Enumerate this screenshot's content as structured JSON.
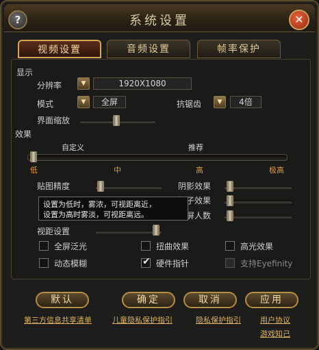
{
  "window": {
    "title": "系统设置",
    "help_label": "?",
    "close_label": "✕"
  },
  "tabs": [
    {
      "label": "视频设置",
      "active": true
    },
    {
      "label": "音频设置",
      "active": false
    },
    {
      "label": "帧率保护",
      "active": false
    }
  ],
  "display": {
    "section": "显示",
    "resolution": {
      "label": "分辨率",
      "value": "1920X1080"
    },
    "mode": {
      "label": "模式",
      "value": "全屏"
    },
    "antialias": {
      "label": "抗锯齿",
      "value": "4倍"
    },
    "ui_scale": {
      "label": "界面缩放"
    },
    "dropdown_arrow": "▼"
  },
  "effects": {
    "section": "效果",
    "preset_top_labels": [
      "自定义",
      "推荐"
    ],
    "preset_ticks": [
      "低",
      "中",
      "高",
      "极高"
    ],
    "texture": {
      "label": "贴图精度"
    },
    "shadow": {
      "label": "阴影效果"
    },
    "particle": {
      "label": "粒子效果"
    },
    "same_screen": {
      "label": "同屏人数"
    },
    "view_distance": {
      "label": "视距设置"
    },
    "tooltip": [
      "设置为低时，雾浓，可视距离近，",
      "设置为高时雾淡，可视距离远。"
    ]
  },
  "checkboxes": [
    {
      "label": "全屏泛光",
      "checked": false,
      "enabled": true
    },
    {
      "label": "扭曲效果",
      "checked": false,
      "enabled": true
    },
    {
      "label": "高光效果",
      "checked": false,
      "enabled": true
    },
    {
      "label": "动态模糊",
      "checked": false,
      "enabled": true
    },
    {
      "label": "硬件指针",
      "checked": true,
      "enabled": true
    },
    {
      "label": "支持Eyefinity",
      "checked": false,
      "enabled": false
    }
  ],
  "check_mark": "✔",
  "buttons": {
    "default": "默认",
    "confirm": "确定",
    "cancel": "取消",
    "apply": "应用"
  },
  "links": [
    "第三方信息共享清单",
    "儿童隐私保护指引",
    "隐私保护指引",
    "用户协议",
    "游戏知己"
  ],
  "colors": {
    "accent_gold": "#d8a552",
    "tick_orange": "#e49a2c",
    "close_red": "#c8431e"
  }
}
